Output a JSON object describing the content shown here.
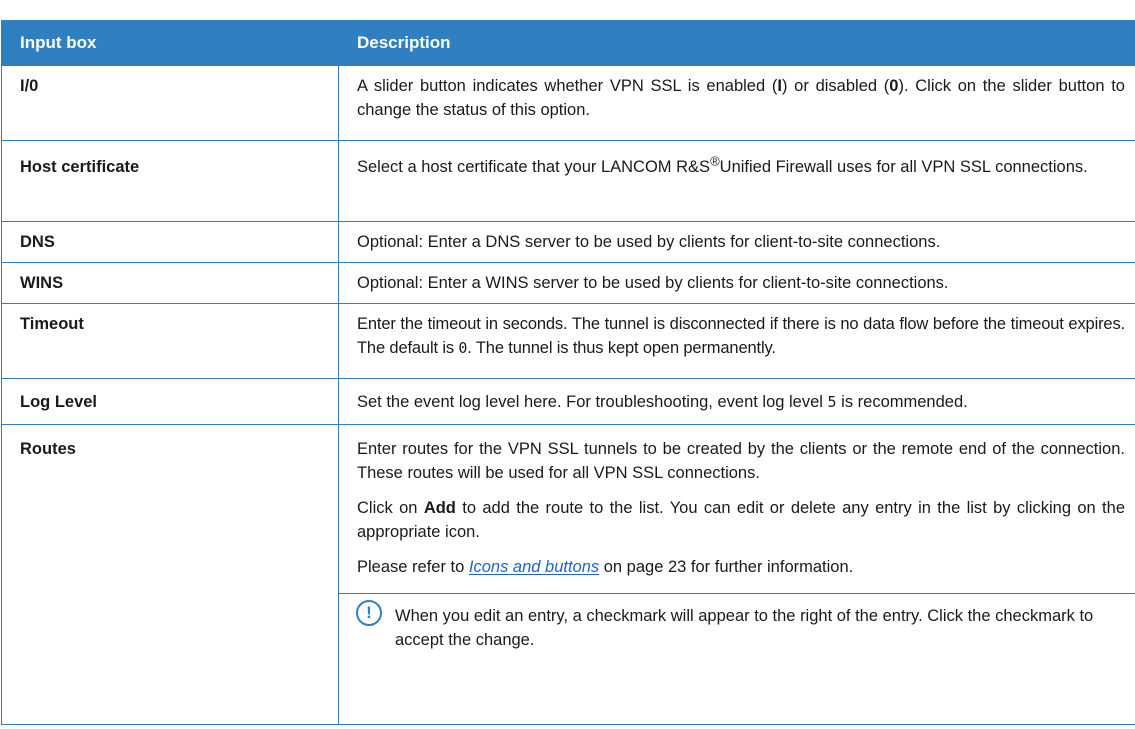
{
  "table": {
    "headers": [
      "Input box",
      "Description"
    ],
    "rows": [
      {
        "name": "I/0",
        "desc_parts": [
          "A slider button indicates whether VPN SSL is enabled (",
          "I",
          ") or disabled (",
          "0",
          "). Click on the slider button to change the status of this option."
        ]
      },
      {
        "name": "Host certificate",
        "desc_parts": [
          "Select a host certificate that your LANCOM R&S",
          "®",
          "Unified Firewall uses for all VPN SSL connections."
        ]
      },
      {
        "name": "DNS",
        "desc": "Optional: Enter a DNS server to be used by clients for client-to-site connections."
      },
      {
        "name": "WINS",
        "desc": "Optional: Enter a WINS server to be used by clients for client-to-site connections."
      },
      {
        "name": "Timeout",
        "desc_parts": [
          "Enter the timeout in seconds. The tunnel is disconnected if there is no data flow before the timeout expires. The default is ",
          "0",
          ". The tunnel is thus kept open permanently."
        ]
      },
      {
        "name": "Log Level",
        "desc_parts": [
          "Set the event log level here. For troubleshooting, event log level ",
          "5",
          " is recommended."
        ]
      },
      {
        "name": "Routes",
        "paragraphs": {
          "p1": "Enter routes for the VPN SSL tunnels to be created by the clients or the remote end of the connection. These routes will be used for all VPN SSL connections.",
          "p2_parts": [
            "Click on ",
            "Add",
            " to add the route to the list. You can edit or delete any entry in the list by clicking on the appropriate icon."
          ],
          "p3_parts": [
            "Please refer to ",
            "Icons and buttons",
            " on page 23 for further information."
          ]
        },
        "note": {
          "icon": "exclamation-circle-icon",
          "symbol": "!",
          "text": "When you edit an entry, a checkmark will appear to the right of the entry. Click the checkmark to accept the change."
        }
      }
    ]
  },
  "colors": {
    "accent": "#2f7fc1",
    "link": "#1f63c6"
  }
}
